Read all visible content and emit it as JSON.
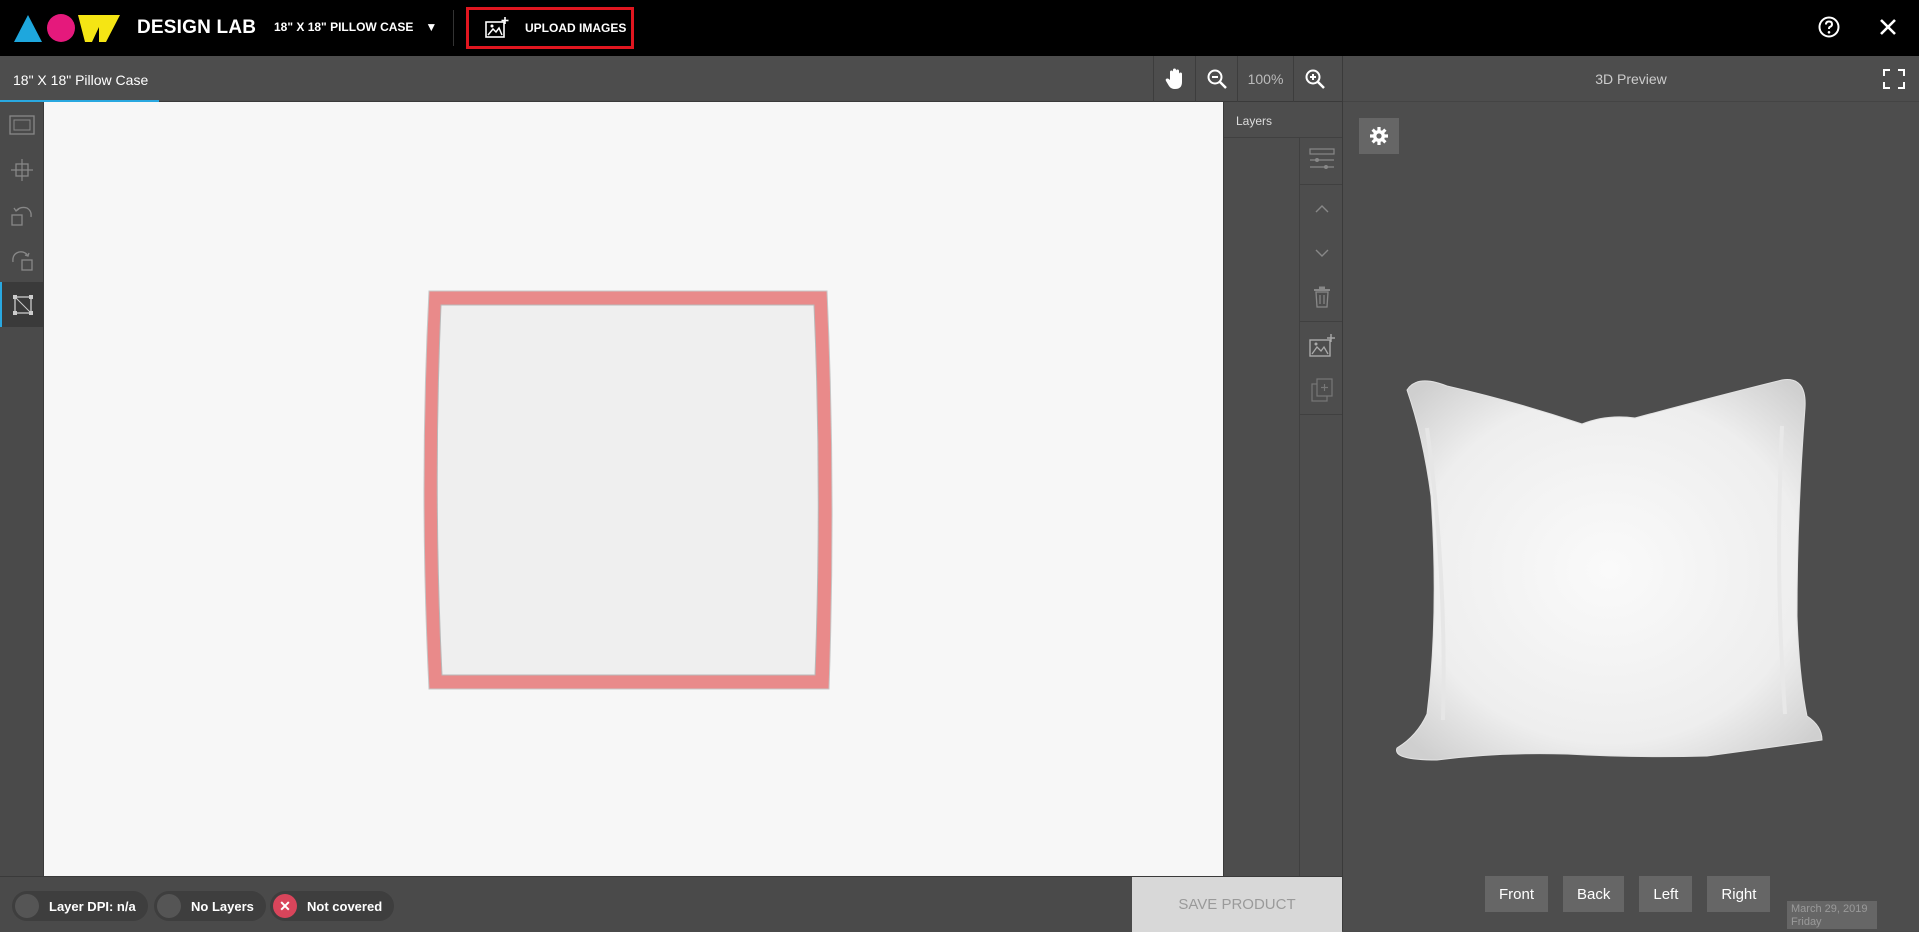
{
  "topbar": {
    "brand": "DESIGN LAB",
    "product_select": "18\" X 18\" PILLOW CASE",
    "upload_label": "UPLOAD IMAGES"
  },
  "subbar": {
    "doc_tab": "18\" X 18\" Pillow Case",
    "zoom": "100%"
  },
  "layers": {
    "title": "Layers"
  },
  "preview": {
    "title": "3D Preview",
    "views": [
      "Front",
      "Back",
      "Left",
      "Right"
    ],
    "date_line1": "March 29, 2019",
    "date_line2": "Friday"
  },
  "status": {
    "dpi": "Layer DPI: n/a",
    "layers": "No Layers",
    "coverage": "Not covered",
    "save": "SAVE PRODUCT"
  },
  "colors": {
    "accent": "#29a8e0",
    "highlight": "#e0161f",
    "error": "#d9455b",
    "logo_cyan": "#1ea7dd",
    "logo_magenta": "#e5197c",
    "logo_yellow": "#f5e514",
    "print_area_border": "#e98a8a"
  },
  "icons": [
    "logo-mark",
    "upload-image-icon",
    "help-icon",
    "close-icon",
    "pan-hand-icon",
    "zoom-out-icon",
    "zoom-in-icon",
    "fit-frame-icon",
    "center-icon",
    "rotate-left-icon",
    "rotate-right-icon",
    "crop-frame-icon",
    "layer-options-icon",
    "chevron-up-icon",
    "chevron-down-icon",
    "trash-icon",
    "add-image-icon",
    "duplicate-icon",
    "fullscreen-icon",
    "gear-icon"
  ]
}
